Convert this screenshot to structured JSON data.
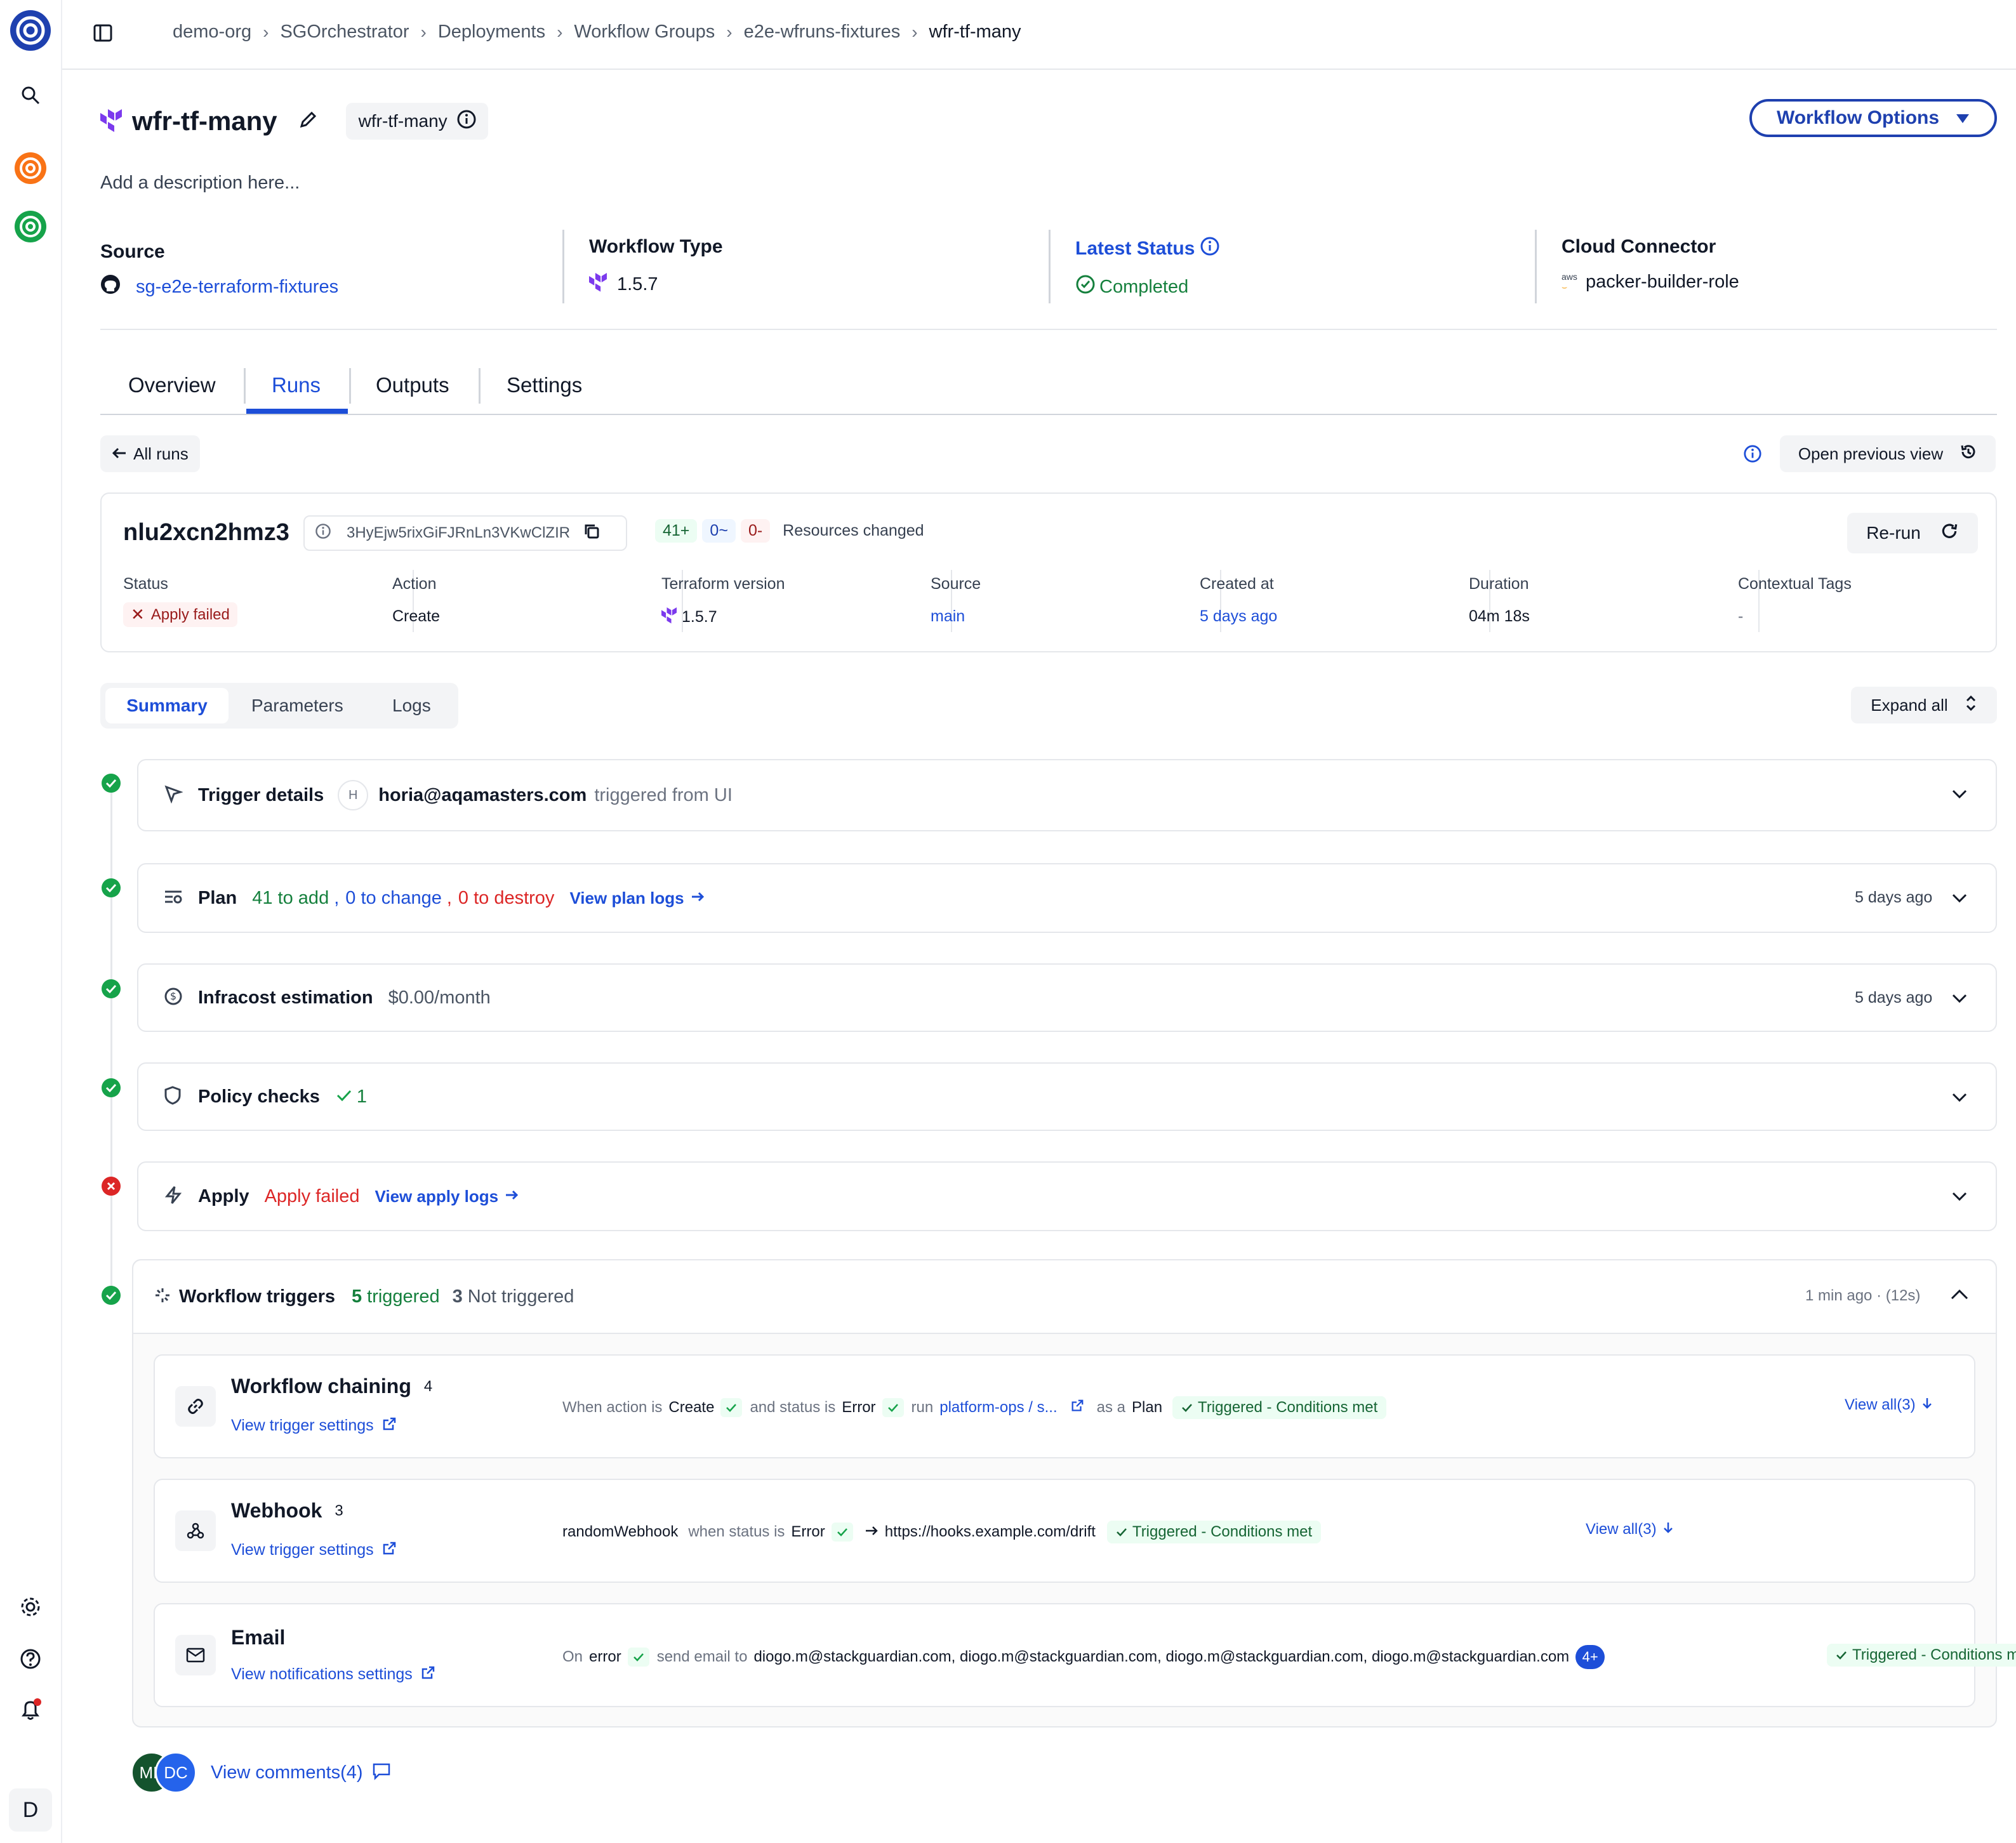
{
  "sidebar": {
    "icons": [
      "logo-icon",
      "search-icon",
      "org-orange-icon",
      "org-green-icon",
      "settings-icon",
      "help-icon",
      "notifications-icon"
    ],
    "user_initial": "D"
  },
  "breadcrumb": [
    "demo-org",
    "SGOrchestrator",
    "Deployments",
    "Workflow Groups",
    "e2e-wfruns-fixtures",
    "wfr-tf-many"
  ],
  "header": {
    "title": "wfr-tf-many",
    "id_pill": "wfr-tf-many",
    "workflow_options": "Workflow Options",
    "description": "Add a description here..."
  },
  "info": {
    "source_label": "Source",
    "source_value": "sg-e2e-terraform-fixtures",
    "type_label": "Workflow Type",
    "type_value": "1.5.7",
    "status_label": "Latest Status",
    "status_value": "Completed",
    "connector_label": "Cloud Connector",
    "connector_value": "packer-builder-role"
  },
  "tabs": [
    "Overview",
    "Runs",
    "Outputs",
    "Settings"
  ],
  "active_tab": "Runs",
  "all_runs": "All runs",
  "open_previous": "Open previous view",
  "run": {
    "id": "nlu2xcn2hmz3",
    "hash": "3HyEjw5rixGiFJRnLn3VKwClZIR",
    "added": "41+",
    "changed": "0~",
    "destroyed": "0-",
    "resources_changed": "Resources changed",
    "rerun": "Re-run",
    "fields": [
      {
        "label": "Status",
        "value": "Apply failed"
      },
      {
        "label": "Action",
        "value": "Create"
      },
      {
        "label": "Terraform version",
        "value": "1.5.7"
      },
      {
        "label": "Source",
        "value": "main"
      },
      {
        "label": "Created at",
        "value": "5 days ago"
      },
      {
        "label": "Duration",
        "value": "04m 18s"
      },
      {
        "label": "Contextual Tags",
        "value": "-"
      }
    ]
  },
  "subtabs": [
    "Summary",
    "Parameters",
    "Logs"
  ],
  "expand_all": "Expand all",
  "steps": {
    "trigger": {
      "title": "Trigger details",
      "avatar": "H",
      "user": "horia@aqamasters.com",
      "text": "triggered from UI"
    },
    "plan": {
      "title": "Plan",
      "add": "41 to add",
      "sep1": ",",
      "change": "0 to change",
      "sep2": ",",
      "destroy": "0 to destroy",
      "logs": "View plan logs",
      "time": "5 days ago"
    },
    "infracost": {
      "title": "Infracost estimation",
      "value": "$0.00/month",
      "time": "5 days ago"
    },
    "policy": {
      "title": "Policy checks",
      "count": "1"
    },
    "apply": {
      "title": "Apply",
      "status": "Apply failed",
      "logs": "View apply logs"
    }
  },
  "triggers": {
    "title": "Workflow triggers",
    "triggered_num": "5",
    "triggered_word": "triggered",
    "not_num": "3",
    "not_word": "Not triggered",
    "time": "1 min ago · (12s)",
    "chaining": {
      "title": "Workflow chaining",
      "count": "4",
      "settings": "View trigger settings",
      "when": "When action is",
      "action": "Create",
      "and": "and status is",
      "status": "Error",
      "run": "run",
      "target": "platform-ops / s...",
      "as": "as a",
      "kind": "Plan",
      "result": "Triggered - Conditions met",
      "view_all": "View all(3)"
    },
    "webhook": {
      "title": "Webhook",
      "count": "3",
      "settings": "View trigger settings",
      "name": "randomWebhook",
      "when": "when status is",
      "status": "Error",
      "url": "https://hooks.example.com/drift",
      "result": "Triggered - Conditions met",
      "view_all": "View all(3)"
    },
    "email": {
      "title": "Email",
      "settings": "View notifications settings",
      "on": "On",
      "event": "error",
      "send": "send email to",
      "recipients": "diogo.m@stackguardian.com, diogo.m@stackguardian.com, diogo.m@stackguardian.com, diogo.m@stackguardian.com",
      "more": "4+",
      "result": "Triggered - Conditions met"
    }
  },
  "comments": {
    "avatars": [
      "ME",
      "DC"
    ],
    "label": "View comments(4)"
  },
  "colors": {
    "accent": "#1d4ed8",
    "success": "#16a34a",
    "error": "#dc2626",
    "brand_dark": "#1e40af"
  }
}
